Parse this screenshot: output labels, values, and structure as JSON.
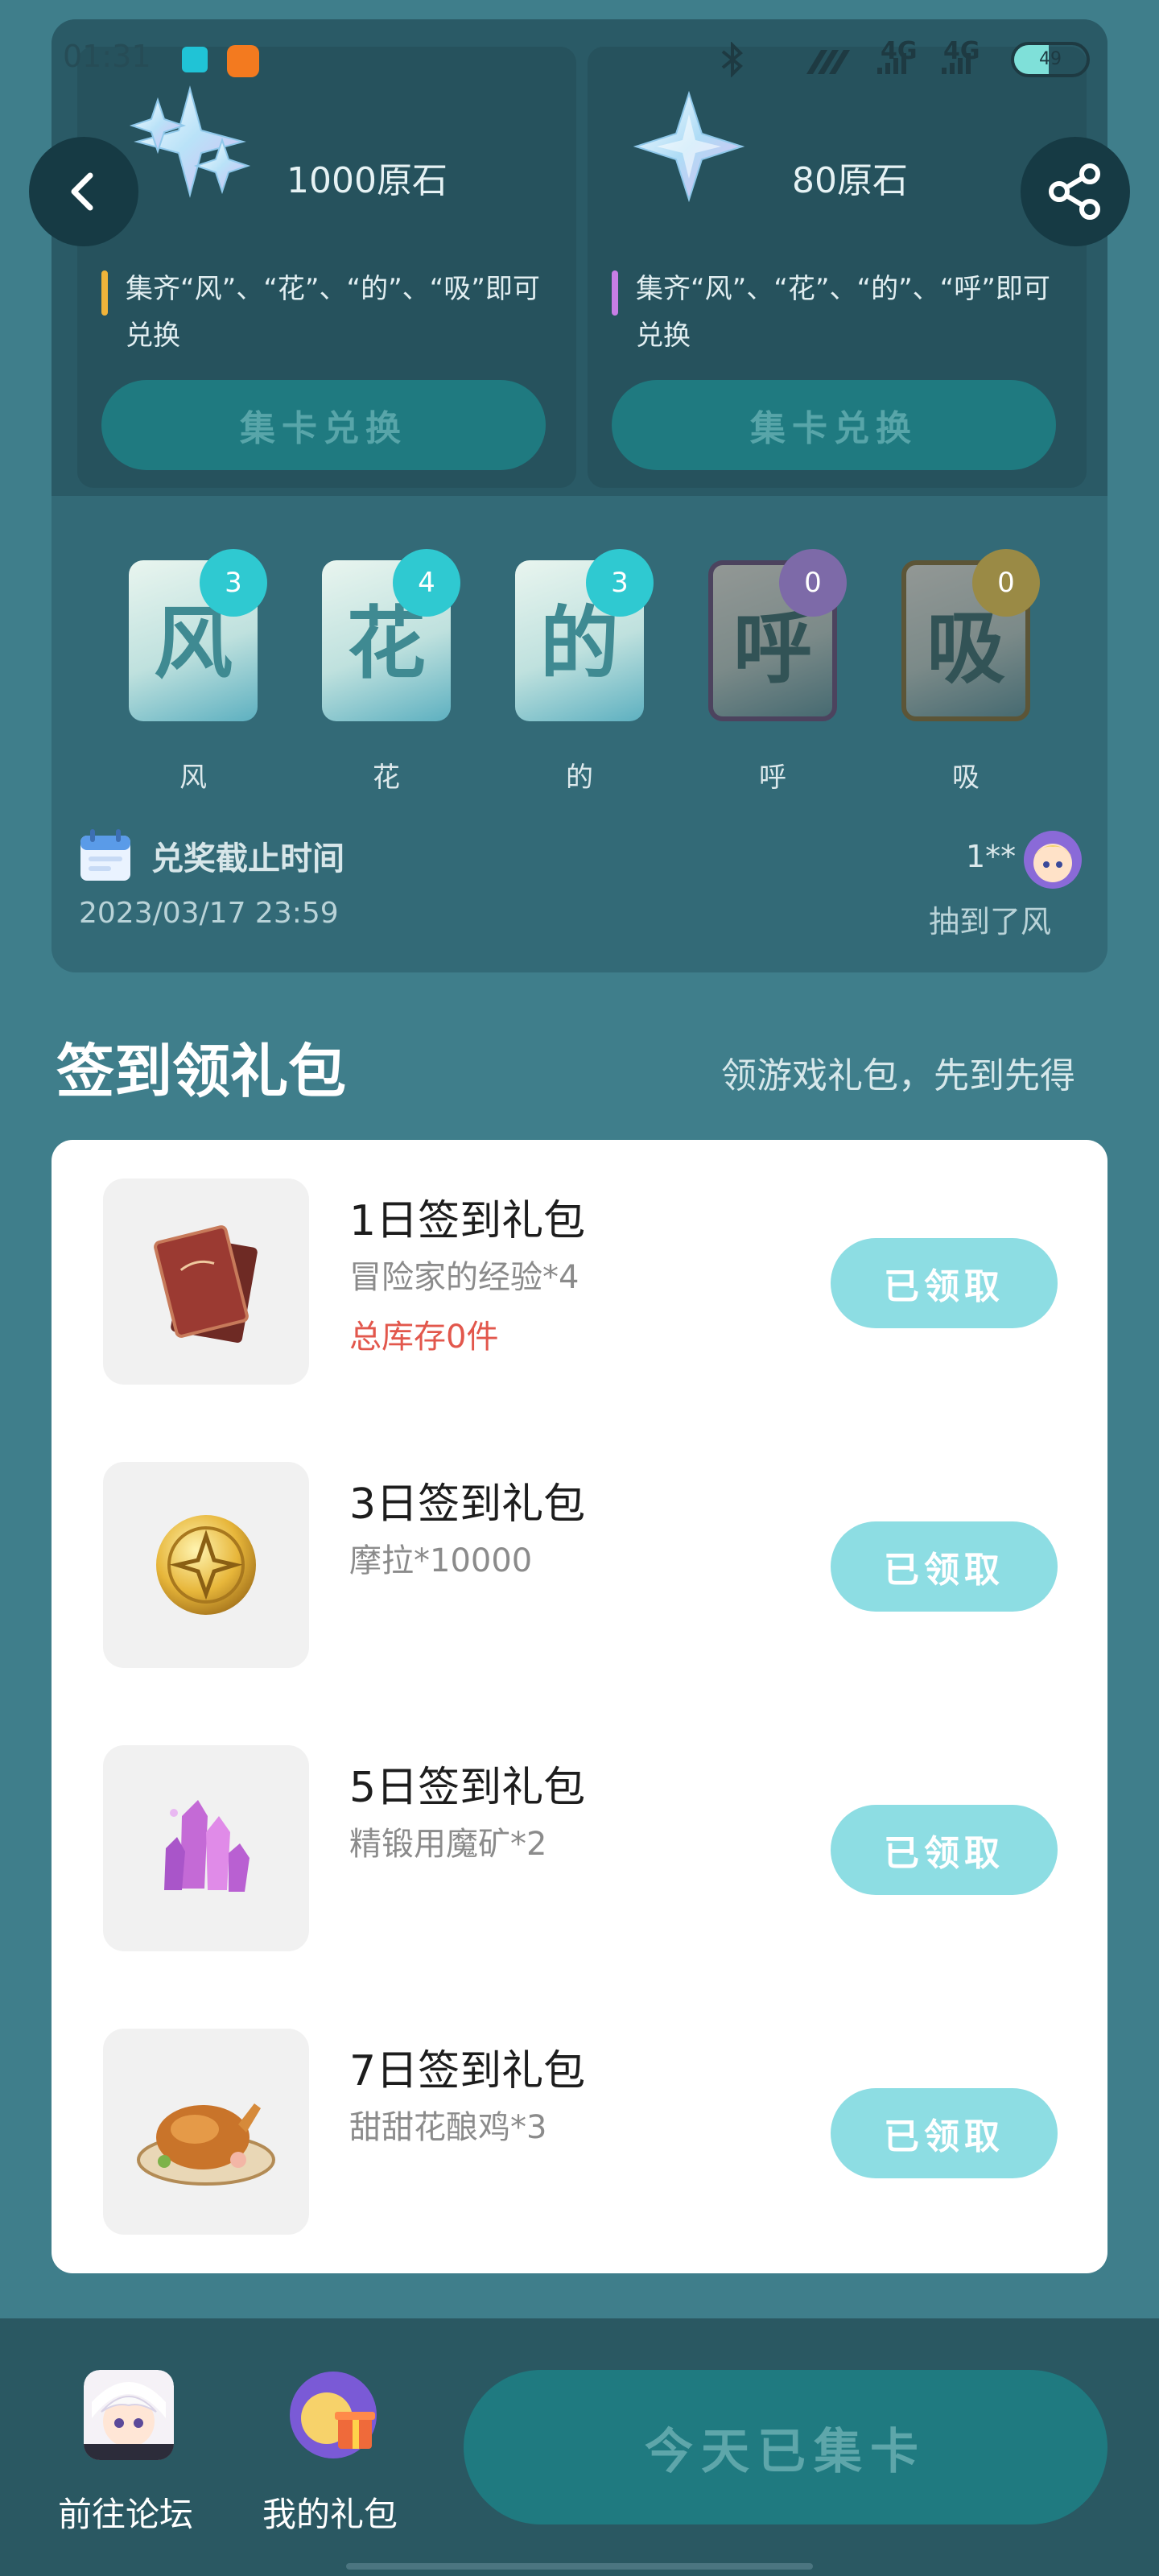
{
  "status_bar": {
    "time": "01:31",
    "network": "4G",
    "battery": "49"
  },
  "prizes": [
    {
      "name": "1000原石",
      "desc": "集齐“风”、“花”、“的”、“吸”即可兑换",
      "button": "集卡兑换",
      "bar_color": "#f0b43a"
    },
    {
      "name": "80原石",
      "desc": "集齐“风”、“花”、“的”、“呼”即可兑换",
      "button": "集卡兑换",
      "bar_color": "#c77ee6"
    }
  ],
  "cards": [
    {
      "char": "风",
      "count": "3",
      "label": "风",
      "badge_color": "#2fc9d1"
    },
    {
      "char": "花",
      "count": "4",
      "label": "花",
      "badge_color": "#2fc9d1"
    },
    {
      "char": "的",
      "count": "3",
      "label": "的",
      "badge_color": "#2fc9d1"
    },
    {
      "char": "呼",
      "count": "0",
      "label": "呼",
      "badge_color": "#7d6aa8"
    },
    {
      "char": "吸",
      "count": "0",
      "label": "吸",
      "badge_color": "#9a8a45"
    }
  ],
  "deadline": {
    "title": "兑奖截止时间",
    "date": "2023/03/17 23:59"
  },
  "winner": {
    "name": "1**",
    "desc": "抽到了风"
  },
  "section": {
    "title": "签到领礼包",
    "subtitle": "领游戏礼包，先到先得"
  },
  "gifts": [
    {
      "title": "1日签到礼包",
      "desc": "冒险家的经验*4",
      "stock": "总库存0件",
      "button": "已领取",
      "icon": "book-icon"
    },
    {
      "title": "3日签到礼包",
      "desc": "摩拉*10000",
      "stock": "",
      "button": "已领取",
      "icon": "mora-coin-icon"
    },
    {
      "title": "5日签到礼包",
      "desc": "精锻用魔矿*2",
      "stock": "",
      "button": "已领取",
      "icon": "crystal-icon"
    },
    {
      "title": "7日签到礼包",
      "desc": "甜甜花酿鸡*3",
      "stock": "",
      "button": "已领取",
      "icon": "roast-chicken-icon"
    }
  ],
  "bottom": {
    "forum_label": "前往论坛",
    "mygift_label": "我的礼包",
    "main_button": "今天已集卡"
  }
}
